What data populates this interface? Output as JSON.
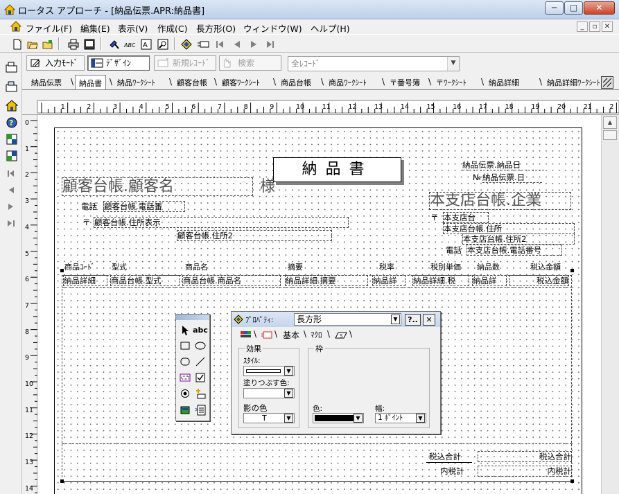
{
  "window": {
    "title": "ロータス アプローチ - [納品伝票.APR:納品書]",
    "caption_buttons": {
      "minimize": "─",
      "maximize": "□",
      "close": "✕"
    },
    "mdi_buttons": {
      "minimize": "_",
      "restore": "▫",
      "close": "✕"
    }
  },
  "menu": [
    "ファイル(F)",
    "編集(E)",
    "表示(V)",
    "作成(C)",
    "長方形(O)",
    "ウィンドウ(W)",
    "ヘルプ(H)"
  ],
  "toolbar2": {
    "browse_label": "入力ﾓｰﾄﾞ",
    "design_label": "ﾃﾞｻﾞｲﾝ",
    "new_record_label": "新規ﾚｺｰﾄﾞ",
    "find_label": "検索",
    "records_combo": "全ﾚｺｰﾄﾞ"
  },
  "view_tabs": [
    "納品伝票",
    "納品書",
    "納品ﾜｰｸｼｰﾄ",
    "顧客台帳",
    "顧客ﾜｰｸｼｰﾄ",
    "商品台帳",
    "商品ﾜｰｸｼｰﾄ",
    "〒番号簿",
    "〒ﾜｰｸｼｰﾄ",
    "納品詳細",
    "納品詳細ﾜｰｸｼｰﾄ"
  ],
  "selected_tab": "納品書",
  "ruler": {
    "h_numbers": [
      "1",
      "2",
      "3",
      "4",
      "5",
      "6",
      "7",
      "8",
      "9",
      "10",
      "11",
      "12",
      "13",
      "14",
      "15",
      "16",
      "17",
      "18",
      "19",
      "20",
      "21",
      "2"
    ],
    "v_numbers": [
      "0",
      "1",
      "2",
      "3",
      "4",
      "5",
      "6",
      "7",
      "8",
      "9",
      "10",
      "11",
      "12",
      "13",
      "14"
    ]
  },
  "form": {
    "title": "納品書",
    "slip_no": "納品伝票.納品日",
    "no_label": "№",
    "no_field": "納品伝票.日",
    "customer_name": "顧客台帳.顧客名",
    "sama": "様",
    "tel_label": "電話",
    "tel_field": "顧客台帳.電話番",
    "zip_mark": "〒",
    "addr1": "顧客台帳.住所表示",
    "addr2": "顧客台帳.住所2",
    "company": "本支店台帳.企業",
    "co_zip": "〒",
    "co_store": "本支店台",
    "co_addr1": "本支店台帳.住所",
    "co_addr2": "本支店台帳.住所2",
    "co_tel_label": "電話",
    "co_tel": "本支店台帳.電話番号",
    "headers": [
      "商品ｺｰﾄﾞ",
      "型式",
      "商品名",
      "摘要",
      "税率",
      "税別単価",
      "納品数",
      "税込金額"
    ],
    "row": [
      "納品詳細",
      "商品台帳.型式",
      "商品台帳.商品名",
      "納品詳細.摘要",
      "納品詳",
      "納品詳細.税",
      "納品詳",
      "税込金額"
    ],
    "total_label": "税込合計",
    "total_field": "税込合計",
    "tax_label": "内税計",
    "tax_field": "内税計"
  },
  "palette": {
    "text_tool": "abc"
  },
  "properties": {
    "caption": "ﾌﾟﾛﾊﾟﾃｨ:",
    "object": "長方形",
    "help_btn": "?..",
    "close_btn": "✕",
    "tab_basic": "基本",
    "tab_macro": "ﾏｸﾛ",
    "group_effect": "効果",
    "group_frame": "枠",
    "style_label": "ｽﾀｲﾙ:",
    "fill_label": "塗りつぶす色:",
    "shadow_label": "影の色",
    "shadow_value": "T",
    "color_label": "色:",
    "width_label": "幅:",
    "width_value": "1 ﾎﾟｲﾝﾄ"
  }
}
